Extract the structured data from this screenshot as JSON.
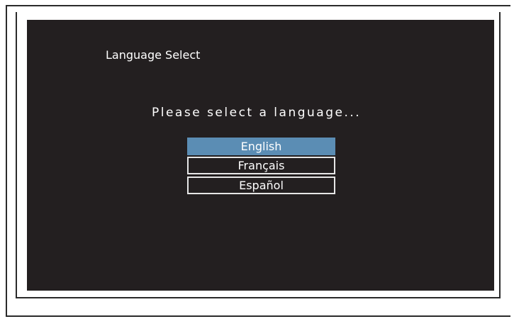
{
  "screen": {
    "title": "Language Select",
    "prompt": "Please select a language...",
    "options": [
      {
        "label": "English",
        "selected": true
      },
      {
        "label": "Français",
        "selected": false
      },
      {
        "label": "Español",
        "selected": false
      }
    ]
  },
  "colors": {
    "screen_background": "#231f20",
    "highlight": "#5b8db4",
    "text": "#ffffff",
    "border": "#e6e6e6"
  }
}
